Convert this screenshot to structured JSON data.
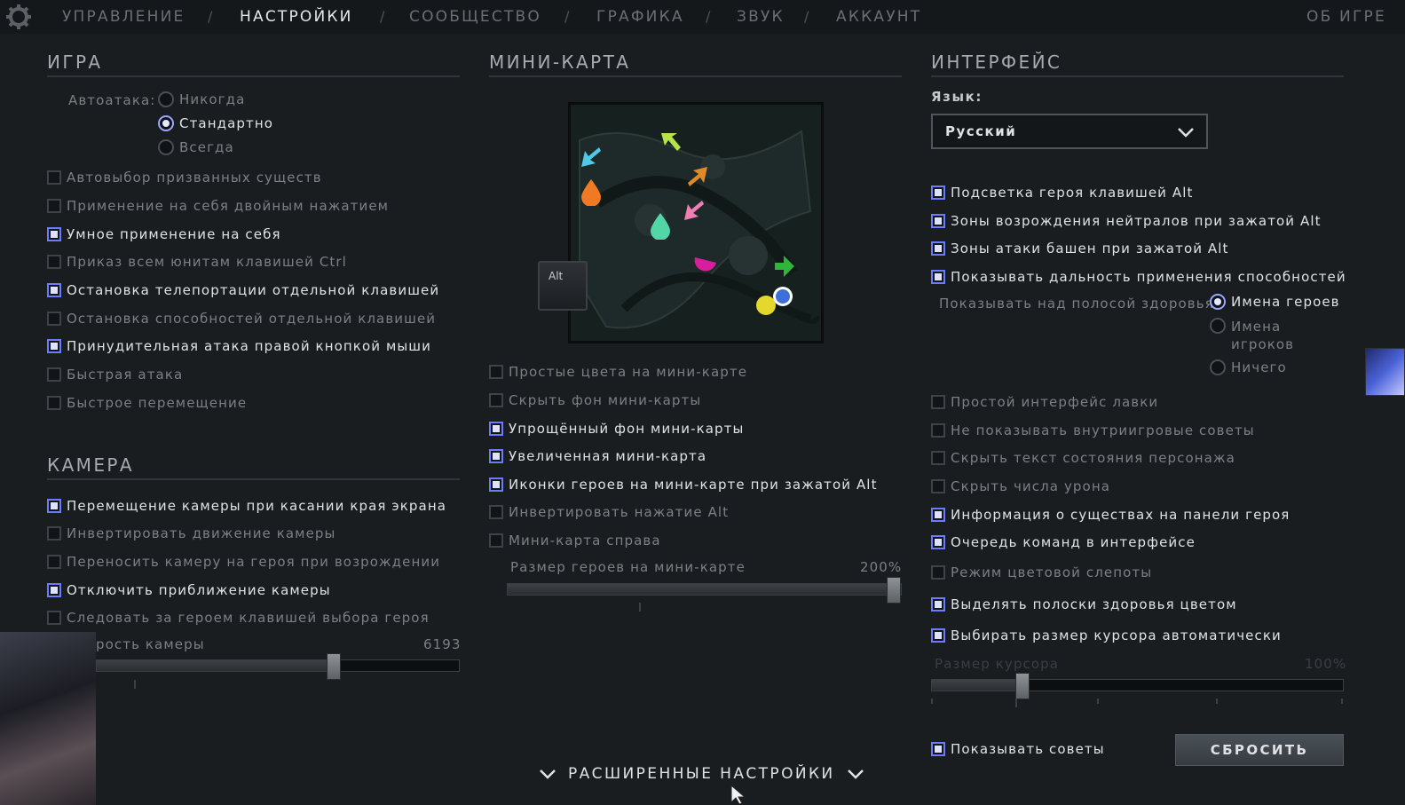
{
  "nav": {
    "items": [
      "УПРАВЛЕНИЕ",
      "НАСТРОЙКИ",
      "СООБЩЕСТВО",
      "ГРАФИКА",
      "ЗВУК",
      "АККАУНТ"
    ],
    "active": "НАСТРОЙКИ",
    "separator": "/",
    "about": "ОБ ИГРЕ"
  },
  "game": {
    "title": "ИГРА",
    "autoattack_label": "Автоатака:",
    "autoattack_options": [
      "Никогда",
      "Стандартно",
      "Всегда"
    ],
    "autoattack_selected": "Стандартно",
    "checkboxes": [
      {
        "label": "Автовыбор призванных существ",
        "checked": false
      },
      {
        "label": "Применение на себя двойным нажатием",
        "checked": false
      },
      {
        "label": "Умное применение на себя",
        "checked": true
      },
      {
        "label": "Приказ всем юнитам клавишей Ctrl",
        "checked": false
      },
      {
        "label": "Остановка телепортации отдельной клавишей",
        "checked": true
      },
      {
        "label": "Остановка способностей отдельной клавишей",
        "checked": false
      },
      {
        "label": "Принудительная атака правой кнопкой мыши",
        "checked": true
      },
      {
        "label": "Быстрая атака",
        "checked": false
      },
      {
        "label": "Быстрое перемещение",
        "checked": false
      }
    ]
  },
  "camera": {
    "title": "КАМЕРА",
    "checkboxes": [
      {
        "label": "Перемещение камеры при касании края экрана",
        "checked": true
      },
      {
        "label": "Инвертировать движение камеры",
        "checked": false
      },
      {
        "label": "Переносить камеру на героя при возрождении",
        "checked": false
      },
      {
        "label": "Отключить приближение камеры",
        "checked": true
      },
      {
        "label": "Следовать за героем клавишей выбора героя",
        "checked": false
      }
    ],
    "speed_label": "рость камеры",
    "speed_value": "6193",
    "speed_fraction": 0.66
  },
  "minimap": {
    "title": "МИНИ-КАРТА",
    "alt_key": "Alt",
    "checkboxes": [
      {
        "label": "Простые цвета на мини-карте",
        "checked": false
      },
      {
        "label": "Скрыть фон мини-карты",
        "checked": false
      },
      {
        "label": "Упрощённый фон мини-карты",
        "checked": true
      },
      {
        "label": "Увеличенная мини-карта",
        "checked": true
      },
      {
        "label": "Иконки героев на мини-карте при зажатой Alt",
        "checked": true
      },
      {
        "label": "Инвертировать нажатие Alt",
        "checked": false
      },
      {
        "label": "Мини-карта справа",
        "checked": false
      }
    ],
    "hero_size_label": "Размер героев на мини-карте",
    "hero_size_value": "200%",
    "hero_size_fraction": 1.0
  },
  "interface": {
    "title": "ИНТЕРФЕЙС",
    "language_label": "Язык:",
    "language_value": "Русский",
    "checkboxes_top": [
      {
        "label": "Подсветка героя клавишей Alt",
        "checked": true
      },
      {
        "label": "Зоны возрождения нейтралов при зажатой Alt",
        "checked": true
      },
      {
        "label": "Зоны атаки башен при зажатой Alt",
        "checked": true
      },
      {
        "label": "Показывать дальность применения способностей",
        "checked": true
      }
    ],
    "healthbar_label": "Показывать над полосой здоровья:",
    "healthbar_options": [
      "Имена героев",
      "Имена игроков",
      "Ничего"
    ],
    "healthbar_selected": "Имена героев",
    "checkboxes_bottom": [
      {
        "label": "Простой интерфейс лавки",
        "checked": false
      },
      {
        "label": "Не показывать внутриигровые советы",
        "checked": false
      },
      {
        "label": "Скрыть текст состояния персонажа",
        "checked": false
      },
      {
        "label": "Скрыть числа урона",
        "checked": false
      },
      {
        "label": "Информация о существах на панели героя",
        "checked": true
      },
      {
        "label": "Очередь команд в интерфейсе",
        "checked": true
      },
      {
        "label": "Режим цветовой слепоты",
        "checked": false
      },
      {
        "label": "Выделять полоски здоровья цветом",
        "checked": true
      },
      {
        "label": "Выбирать размер курсора автоматически",
        "checked": true
      }
    ],
    "cursor_size_label": "Размер курсора",
    "cursor_size_value": "100%",
    "cursor_size_fraction": 0.21,
    "show_tips": {
      "label": "Показывать советы",
      "checked": true
    },
    "reset_label": "СБРОСИТЬ"
  },
  "advanced_label": "РАСШИРЕННЫЕ НАСТРОЙКИ",
  "colors": {
    "accent": "#6c7cff",
    "background": "#1a1d20"
  }
}
